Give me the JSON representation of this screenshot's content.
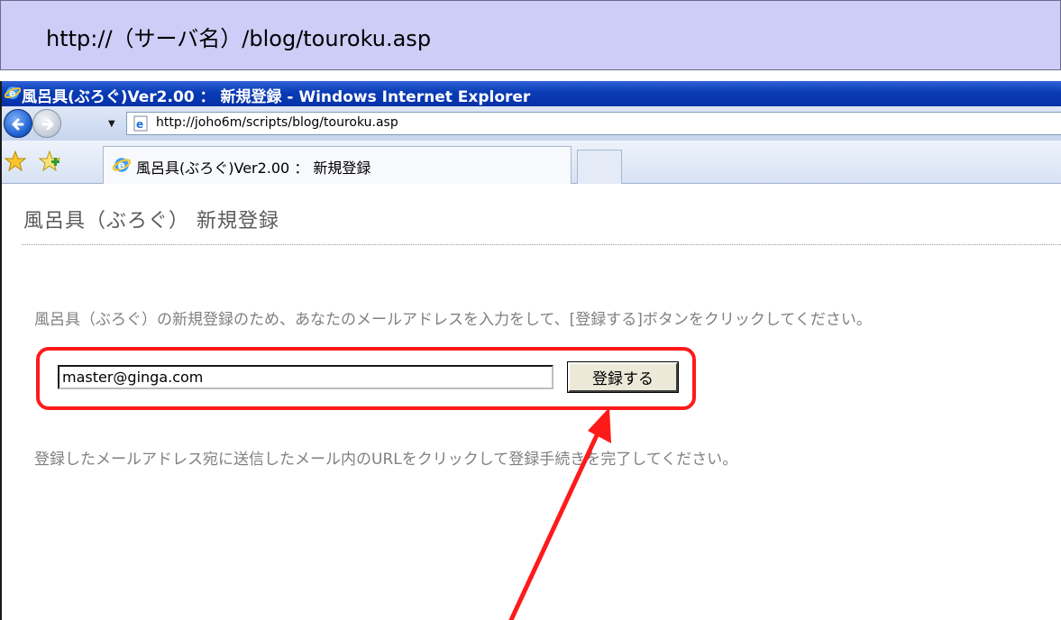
{
  "banner": {
    "url_label": "http://（サーバ名）/blog/touroku.asp"
  },
  "browser": {
    "window_title": "風呂具(ぶろぐ)Ver2.00 ： 新規登録 - Windows Internet Explorer",
    "address": "http://joho6m/scripts/blog/touroku.asp",
    "tab_label": "風呂具(ぶろぐ)Ver2.00 ： 新規登録",
    "icons": [
      "ie-icon",
      "back-icon",
      "forward-icon",
      "dropdown-icon",
      "favorites-star-icon",
      "add-favorites-icon"
    ]
  },
  "page": {
    "title": "風呂具（ぶろぐ） 新規登録",
    "instruction": "風呂具（ぶろぐ）の新規登録のため、あなたのメールアドレスを入力をして、[登録する]ボタンをクリックしてください。",
    "email_value": "master@ginga.com",
    "register_button": "登録する",
    "followup": "登録したメールアドレス宛に送信したメール内のURLをクリックして登録手続きを完了してください。"
  },
  "colors": {
    "banner_bg": "#cdcdf7",
    "titlebar": "#0a3bb5",
    "annotation_red": "#ff1a1a",
    "body_text": "#808080"
  }
}
